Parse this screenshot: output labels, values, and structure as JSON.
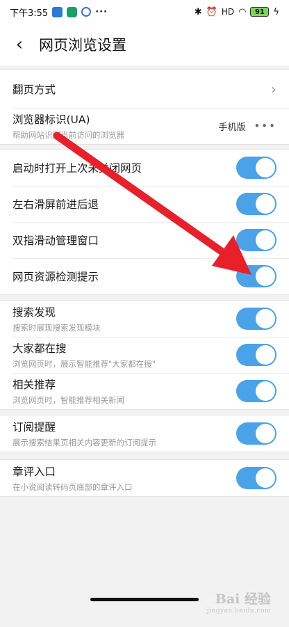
{
  "status_bar": {
    "time": "下午3:55",
    "more": "···",
    "signal": "HD",
    "battery": "91"
  },
  "header": {
    "back": "‹",
    "title": "网页浏览设置"
  },
  "groups": [
    {
      "rows": [
        {
          "title": "翻页方式",
          "control": "chevron"
        },
        {
          "title": "浏览器标识(UA)",
          "subtitle": "帮助网站识别当前访问的浏览器",
          "value": "手机版",
          "control": "more"
        }
      ]
    },
    {
      "rows": [
        {
          "title": "启动时打开上次未关闭网页",
          "control": "toggle",
          "on": true
        },
        {
          "title": "左右滑屏前进后退",
          "control": "toggle",
          "on": true
        },
        {
          "title": "双指滑动管理窗口",
          "control": "toggle",
          "on": true
        },
        {
          "title": "网页资源检测提示",
          "control": "toggle",
          "on": true
        }
      ]
    },
    {
      "rows": [
        {
          "title": "搜索发现",
          "subtitle": "搜索时展现搜索发现模块",
          "control": "toggle",
          "on": true
        },
        {
          "title": "大家都在搜",
          "subtitle": "浏览网页时，展示智能推荐\"大家都在搜\"",
          "control": "toggle",
          "on": true
        },
        {
          "title": "相关推荐",
          "subtitle": "浏览网页时，智能推荐相关新闻",
          "control": "toggle",
          "on": true
        }
      ]
    },
    {
      "rows": [
        {
          "title": "订阅提醒",
          "subtitle": "展示搜索结果页相关内容更新的订阅提示",
          "control": "toggle",
          "on": true
        }
      ]
    },
    {
      "rows": [
        {
          "title": "章评入口",
          "subtitle": "在小说阅读转码页底部的章评入口",
          "control": "toggle",
          "on": true
        }
      ]
    }
  ],
  "colors": {
    "toggle_on": "#4aa3e8",
    "annotation_arrow": "#e8202a"
  },
  "watermark": {
    "main": "Bai 经验",
    "sub": "jingyan.baidu.com"
  }
}
